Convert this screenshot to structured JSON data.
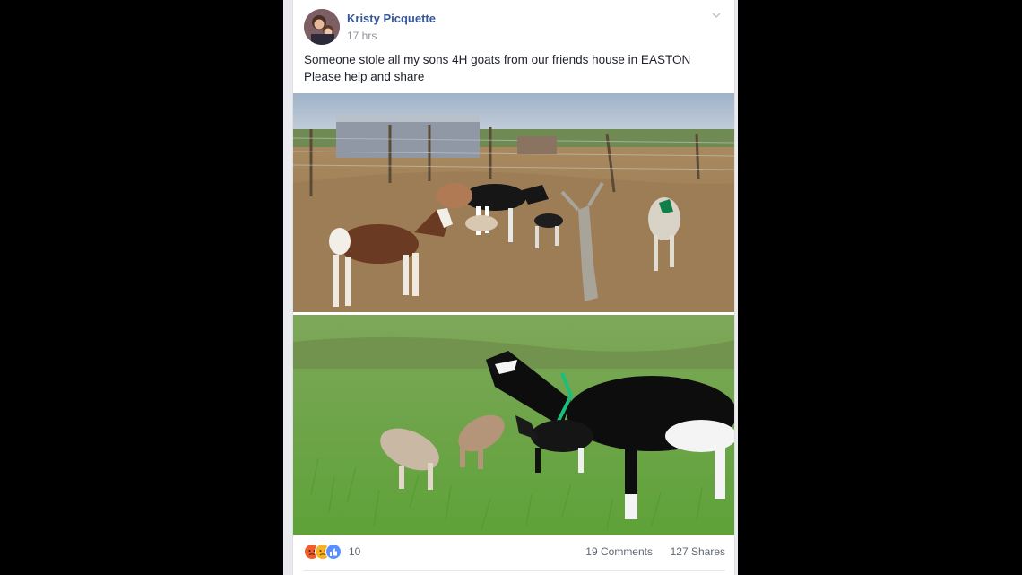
{
  "post": {
    "author_name": "Kristy Picquette",
    "timestamp": "17 hrs",
    "text_lines": [
      "Someone stole all my sons 4H goats from our friends house in EASTON",
      "Please help and share"
    ],
    "photos": [
      {
        "description_icon": "goat-pen-photo"
      },
      {
        "description_icon": "goats-on-grass-photo"
      }
    ],
    "reactions": {
      "icons": [
        "angry-reaction-icon",
        "sad-reaction-icon",
        "like-reaction-icon"
      ],
      "count": "10"
    },
    "comments_label": "19 Comments",
    "shares_label": "127 Shares"
  },
  "colors": {
    "author_link": "#365899",
    "meta_gray": "#90949c",
    "body_text": "#1d2129",
    "feed_bg": "#e9ebee",
    "like_blue": "#5890ff",
    "angry_orange": "#f05d2c",
    "sad_yellow": "#f7b125"
  }
}
